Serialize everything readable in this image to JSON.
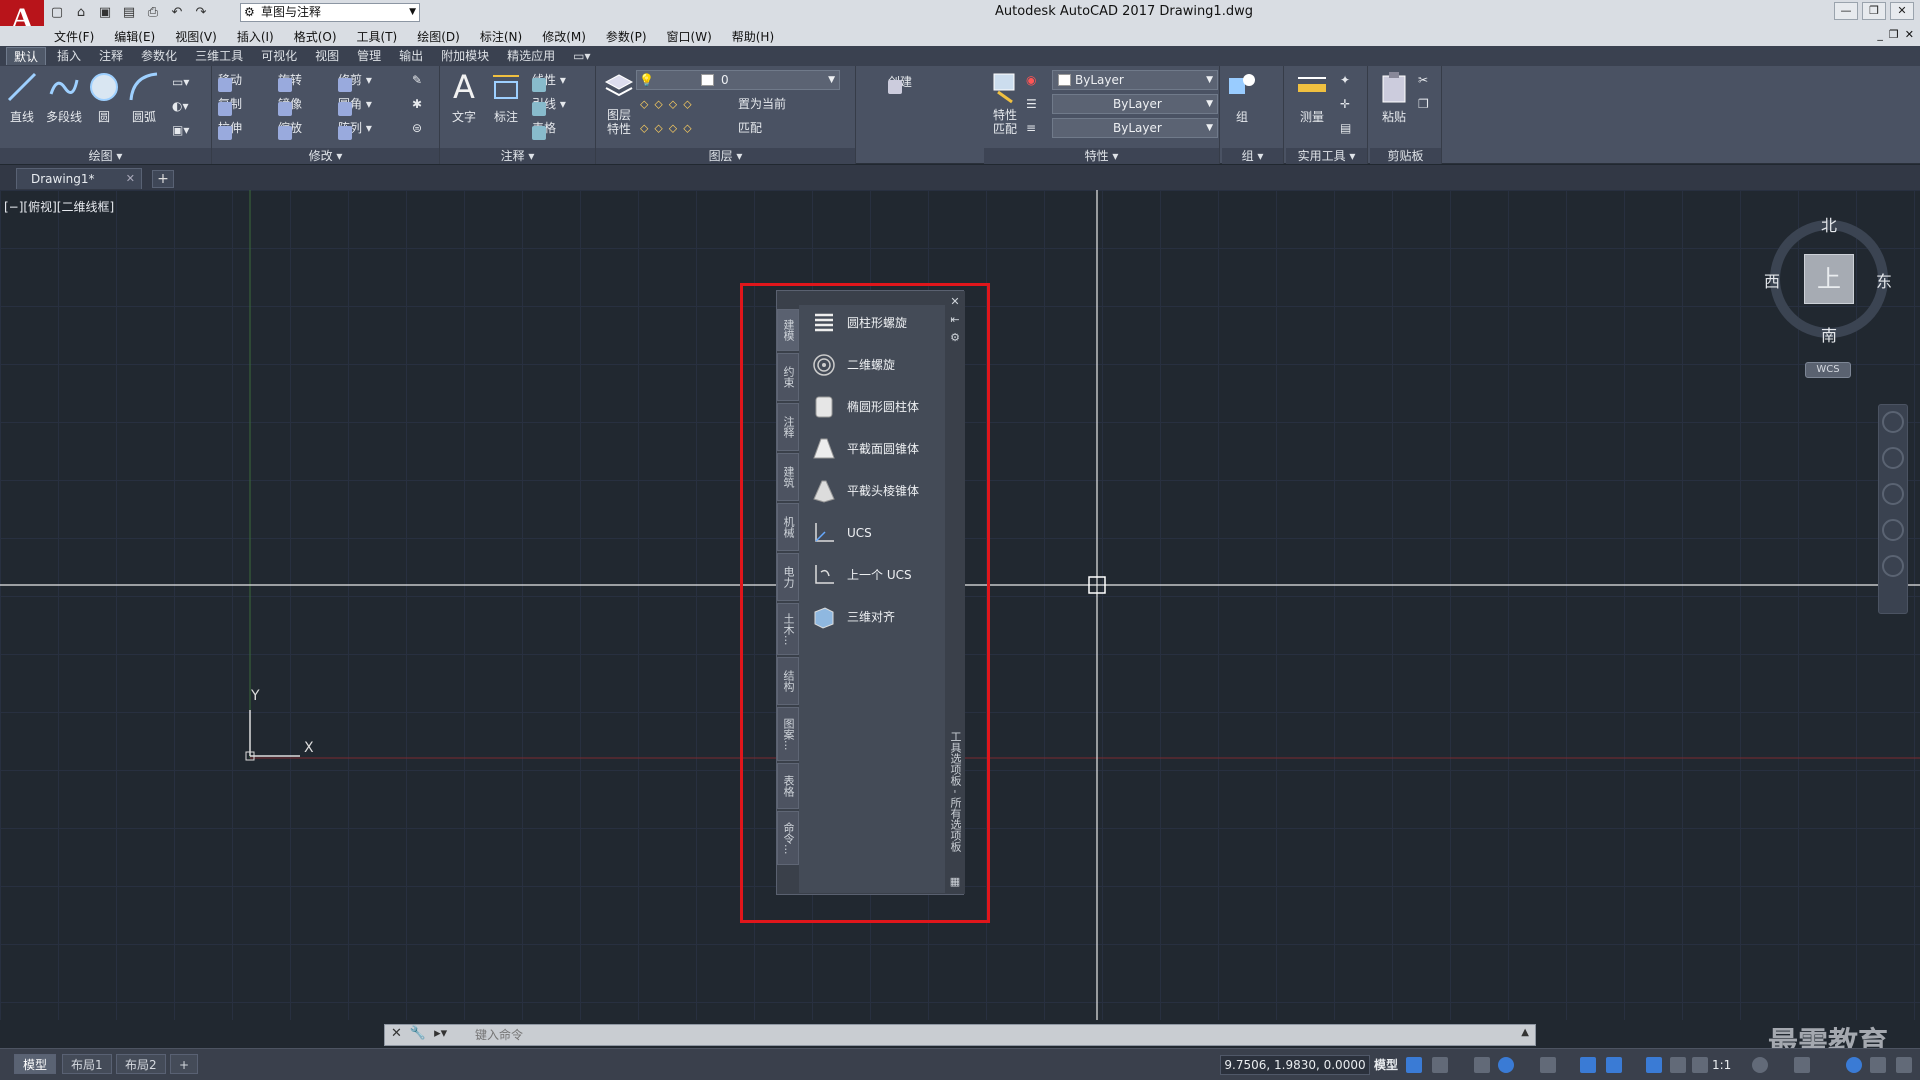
{
  "window": {
    "title": "Autodesk AutoCAD 2017    Drawing1.dwg",
    "logo": "A",
    "workspace": "草图与注释",
    "controls": [
      "—",
      "❐",
      "✕"
    ]
  },
  "menubar": {
    "items": [
      "文件(F)",
      "编辑(E)",
      "视图(V)",
      "插入(I)",
      "格式(O)",
      "工具(T)",
      "绘图(D)",
      "标注(N)",
      "修改(M)",
      "参数(P)",
      "窗口(W)",
      "帮助(H)"
    ]
  },
  "ribbon_tabs": [
    "默认",
    "插入",
    "注释",
    "参数化",
    "三维工具",
    "可视化",
    "视图",
    "管理",
    "输出",
    "附加模块",
    "精选应用"
  ],
  "ribbon": {
    "draw": {
      "title": "绘图",
      "big": [
        "直线",
        "多段线",
        "圆",
        "圆弧"
      ]
    },
    "modify": {
      "title": "修改",
      "rows": [
        [
          "移动",
          "旋转",
          "修剪"
        ],
        [
          "复制",
          "镜像",
          "圆角"
        ],
        [
          "拉伸",
          "缩放",
          "阵列"
        ]
      ]
    },
    "annotation": {
      "title": "注释",
      "big": [
        "文字",
        "标注"
      ],
      "small": [
        "线性",
        "引线",
        "表格"
      ]
    },
    "layers": {
      "title": "图层",
      "big": "图层\n特性",
      "layer_value": "0",
      "small": [
        "置为当前",
        "匹配"
      ]
    },
    "block": {
      "create": "创建"
    },
    "properties": {
      "title": "特性",
      "big": "特性\n匹配",
      "color": "ByLayer",
      "linetype": "ByLayer",
      "lineweight": "ByLayer"
    },
    "groups": {
      "title": "组",
      "big": "组"
    },
    "utilities": {
      "title": "实用工具",
      "big": "测量"
    },
    "clipboard": {
      "title": "剪贴板",
      "big": "粘贴"
    }
  },
  "doc_tab": {
    "name": "Drawing1*"
  },
  "viewport": {
    "label": "[−][俯视][二维线框]",
    "ucs_x": "X",
    "ucs_y": "Y"
  },
  "viewcube": {
    "face": "上",
    "north": "北",
    "south": "南",
    "east": "东",
    "west": "西",
    "wcs": "WCS"
  },
  "palette": {
    "title": "工具选项板 - 所有选项板",
    "tabs": [
      "建模",
      "约束",
      "注释",
      "建筑",
      "机械",
      "电力",
      "土木...",
      "结构",
      "图案...",
      "表格",
      "命令..."
    ],
    "items": [
      {
        "label": "圆柱形螺旋",
        "icon": "helix-cylindrical-icon"
      },
      {
        "label": "二维螺旋",
        "icon": "helix-2d-icon"
      },
      {
        "label": "椭圆形圆柱体",
        "icon": "elliptical-cylinder-icon"
      },
      {
        "label": "平截面圆锥体",
        "icon": "frustum-cone-icon"
      },
      {
        "label": "平截头棱锥体",
        "icon": "frustum-pyramid-icon"
      },
      {
        "label": "UCS",
        "icon": "ucs-icon"
      },
      {
        "label": "上一个 UCS",
        "icon": "ucs-previous-icon"
      },
      {
        "label": "三维对齐",
        "icon": "align-3d-icon"
      }
    ]
  },
  "command": {
    "placeholder": "键入命令"
  },
  "statusbar": {
    "layouts": [
      "模型",
      "布局1",
      "布局2"
    ],
    "coords": "9.7506, 1.9830, 0.0000",
    "mode": "模型",
    "scale": "1:1"
  },
  "watermark": "最需教育",
  "colors": {
    "canvas": "#212830",
    "ribbon": "#4a5263",
    "highlight": "#e0161b",
    "logo": "#b8141a"
  }
}
